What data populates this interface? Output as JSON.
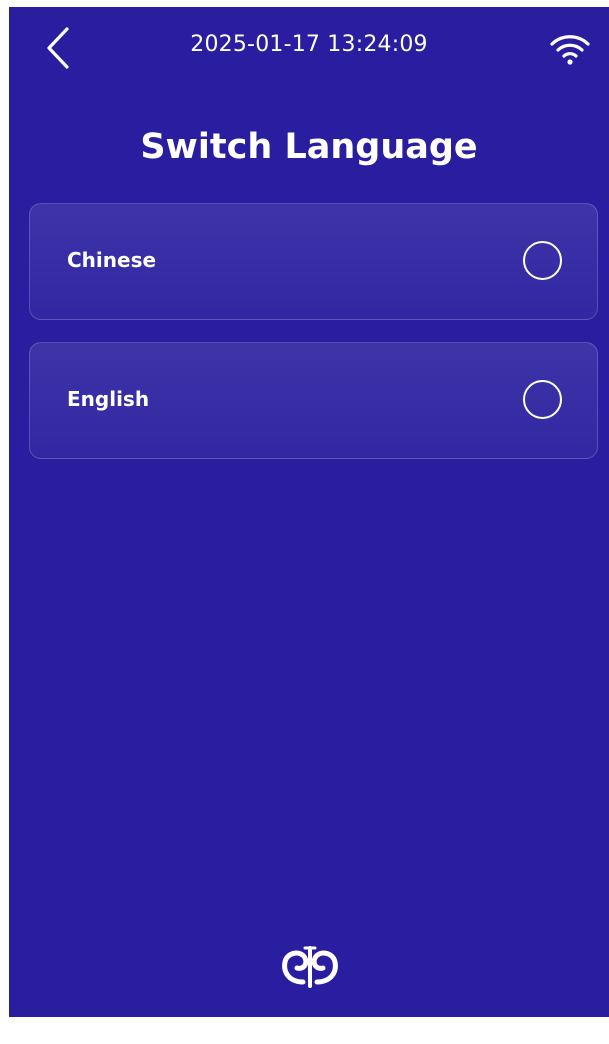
{
  "status_bar": {
    "datetime": "2025-01-17 13:24:09",
    "back_icon": "chevron-left-icon",
    "wifi_icon": "wifi-icon"
  },
  "page": {
    "title": "Switch Language"
  },
  "languages": [
    {
      "label": "Chinese",
      "selected": false
    },
    {
      "label": "English",
      "selected": false
    }
  ],
  "footer": {
    "logo_icon": "brand-logo-icon"
  },
  "colors": {
    "background": "#281e9f",
    "text": "#ffffff",
    "card_border": "rgba(255,255,255,0.18)"
  }
}
